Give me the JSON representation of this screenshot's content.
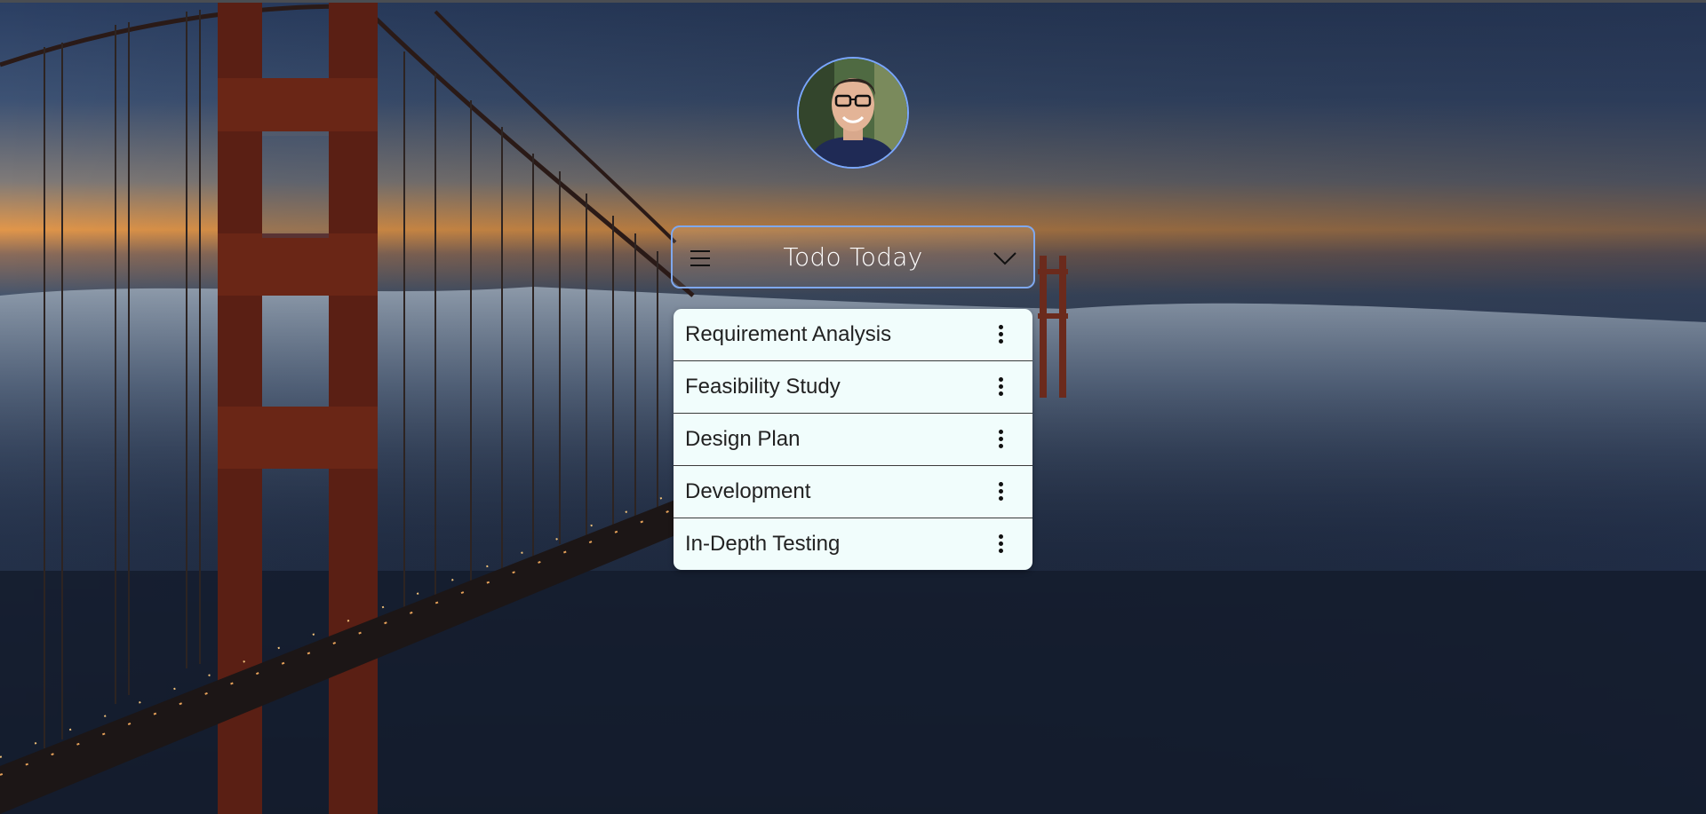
{
  "header": {
    "title": "Todo Today",
    "menu_icon": "hamburger-menu-icon",
    "expand_icon": "chevron-down-icon"
  },
  "profile": {
    "avatar_icon": "user-avatar"
  },
  "todos": [
    {
      "label": "Requirement Analysis",
      "options_icon": "kebab-menu-icon"
    },
    {
      "label": "Feasibility Study",
      "options_icon": "kebab-menu-icon"
    },
    {
      "label": "Design Plan",
      "options_icon": "kebab-menu-icon"
    },
    {
      "label": "Development",
      "options_icon": "kebab-menu-icon"
    },
    {
      "label": "In-Depth Testing",
      "options_icon": "kebab-menu-icon"
    }
  ],
  "colors": {
    "header_border": "#7fa8ee",
    "list_background": "#f1fdfc",
    "avatar_border": "#7aa6ff"
  }
}
